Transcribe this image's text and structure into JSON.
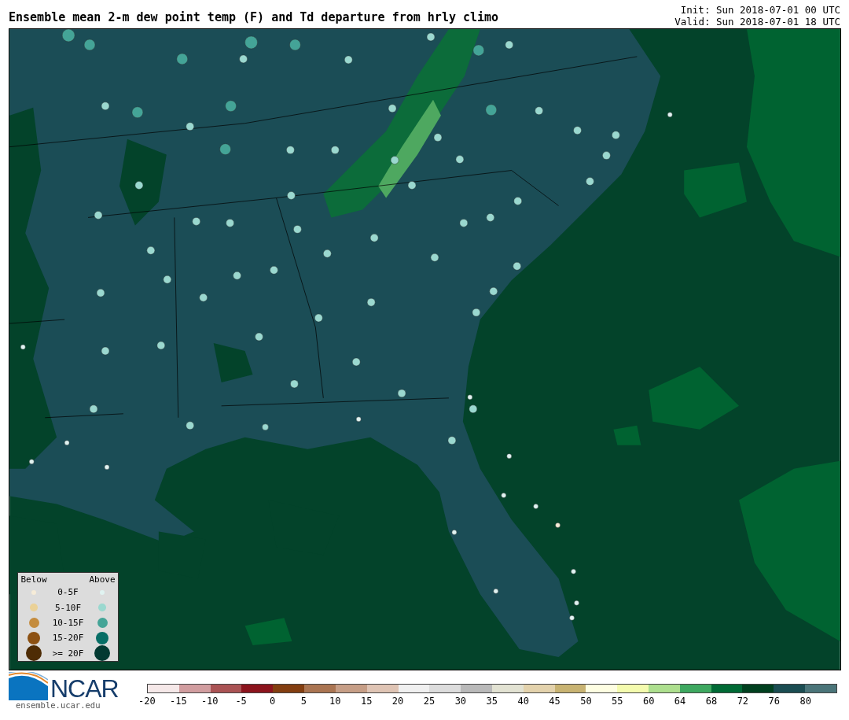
{
  "header": {
    "title": "Ensemble mean 2-m dew point temp (F) and Td departure from hrly climo",
    "init": "Init: Sun 2018-07-01 00 UTC",
    "valid": "Valid: Sun 2018-07-01 18 UTC"
  },
  "legend": {
    "below_heading": "Below",
    "above_heading": "Above",
    "rows": [
      {
        "label": "0-5F",
        "below": {
          "color": "#f6ecd8"
        },
        "above": {
          "color": "#e0f3f1"
        }
      },
      {
        "label": "5-10F",
        "below": {
          "color": "#ead197"
        },
        "above": {
          "color": "#9ad8cf"
        }
      },
      {
        "label": "10-15F",
        "below": {
          "color": "#c48c3e"
        },
        "above": {
          "color": "#44a497"
        }
      },
      {
        "label": "15-20F",
        "below": {
          "color": "#8c5113"
        },
        "above": {
          "color": "#076e66"
        }
      },
      {
        "label": ">= 20F",
        "below": {
          "color": "#4e2c05"
        },
        "above": {
          "color": "#033a32"
        }
      }
    ]
  },
  "logo": {
    "name": "NCAR",
    "url": "ensemble.ucar.edu"
  },
  "colorbar": {
    "segments": [
      {
        "color": "#f5e8e8"
      },
      {
        "color": "#d19d9f"
      },
      {
        "color": "#aa5354"
      },
      {
        "color": "#8c141d"
      },
      {
        "color": "#833e10"
      },
      {
        "color": "#aa7552"
      },
      {
        "color": "#c69e86"
      },
      {
        "color": "#dfc4b4"
      },
      {
        "color": "#f0f0f0"
      },
      {
        "color": "#dcdcdc"
      },
      {
        "color": "#b9b9b9"
      },
      {
        "color": "#e2e2d2"
      },
      {
        "color": "#e3d2ac"
      },
      {
        "color": "#c8b372"
      },
      {
        "color": "#fefee2"
      },
      {
        "color": "#f4fbae"
      },
      {
        "color": "#addf8e"
      },
      {
        "color": "#3ea860"
      },
      {
        "color": "#006a35"
      },
      {
        "color": "#00401f"
      },
      {
        "color": "#1b4d52"
      },
      {
        "color": "#4b7579"
      }
    ],
    "ticks": [
      "-20",
      "-15",
      "-10",
      "-5",
      "0",
      "5",
      "10",
      "15",
      "20",
      "25",
      "30",
      "35",
      "40",
      "45",
      "50",
      "55",
      "60",
      "64",
      "68",
      "72",
      "76",
      "80"
    ]
  }
}
